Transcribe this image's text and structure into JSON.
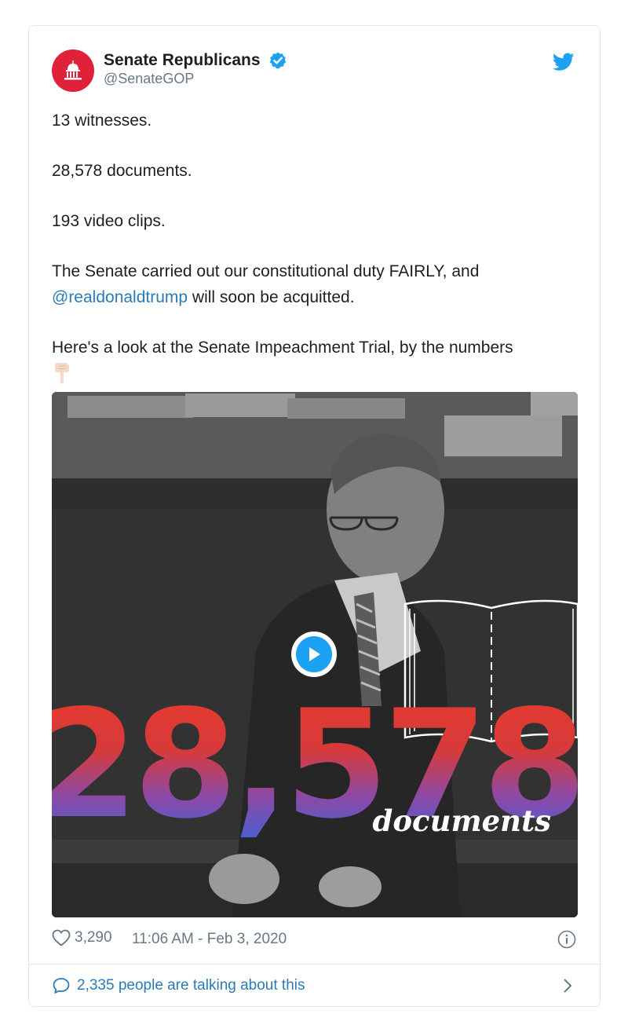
{
  "tweet": {
    "display_name": "Senate Republicans",
    "handle": "@SenateGOP",
    "lines": {
      "l1": "13 witnesses.",
      "l2": "28,578 documents.",
      "l3": "193 video clips.",
      "l4_start": "The Senate carried out our constitutional duty FAIRLY, and",
      "l4_mention": "@realdonaldtrump",
      "l4_end": " will soon be acquitted.",
      "l5": "Here's a look at the Senate Impeachment Trial, by the numbers"
    },
    "emoji": "pointing-down-emoji",
    "media": {
      "big_number": "28,578",
      "caption": "documents"
    },
    "likes": "3,290",
    "timestamp": "11:06 AM - Feb 3, 2020",
    "talking": "2,335 people are talking about this"
  },
  "icons": [
    "capitol-icon",
    "verified-badge-icon",
    "twitter-bird-icon",
    "play-icon",
    "heart-icon",
    "info-icon",
    "speech-bubble-icon",
    "chevron-right-icon"
  ],
  "colors": {
    "avatar_bg": "#e0213a",
    "twitter_blue": "#1da1f2",
    "link_blue": "#2b7bb9",
    "meta_gray": "#697882",
    "border": "#e1e8ed"
  }
}
